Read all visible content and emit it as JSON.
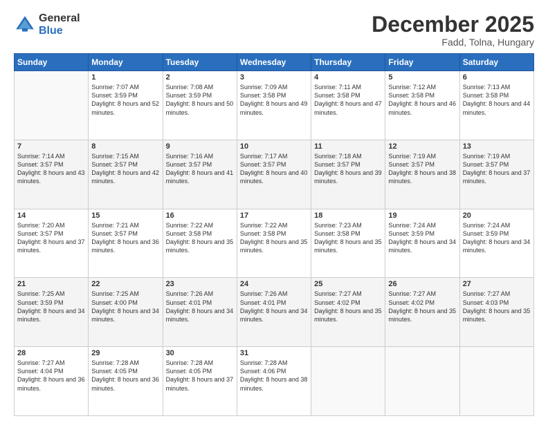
{
  "logo": {
    "general": "General",
    "blue": "Blue"
  },
  "header": {
    "month": "December 2025",
    "location": "Fadd, Tolna, Hungary"
  },
  "weekdays": [
    "Sunday",
    "Monday",
    "Tuesday",
    "Wednesday",
    "Thursday",
    "Friday",
    "Saturday"
  ],
  "weeks": [
    [
      {
        "day": "",
        "sunrise": "",
        "sunset": "",
        "daylight": ""
      },
      {
        "day": "1",
        "sunrise": "Sunrise: 7:07 AM",
        "sunset": "Sunset: 3:59 PM",
        "daylight": "Daylight: 8 hours and 52 minutes."
      },
      {
        "day": "2",
        "sunrise": "Sunrise: 7:08 AM",
        "sunset": "Sunset: 3:59 PM",
        "daylight": "Daylight: 8 hours and 50 minutes."
      },
      {
        "day": "3",
        "sunrise": "Sunrise: 7:09 AM",
        "sunset": "Sunset: 3:58 PM",
        "daylight": "Daylight: 8 hours and 49 minutes."
      },
      {
        "day": "4",
        "sunrise": "Sunrise: 7:11 AM",
        "sunset": "Sunset: 3:58 PM",
        "daylight": "Daylight: 8 hours and 47 minutes."
      },
      {
        "day": "5",
        "sunrise": "Sunrise: 7:12 AM",
        "sunset": "Sunset: 3:58 PM",
        "daylight": "Daylight: 8 hours and 46 minutes."
      },
      {
        "day": "6",
        "sunrise": "Sunrise: 7:13 AM",
        "sunset": "Sunset: 3:58 PM",
        "daylight": "Daylight: 8 hours and 44 minutes."
      }
    ],
    [
      {
        "day": "7",
        "sunrise": "Sunrise: 7:14 AM",
        "sunset": "Sunset: 3:57 PM",
        "daylight": "Daylight: 8 hours and 43 minutes."
      },
      {
        "day": "8",
        "sunrise": "Sunrise: 7:15 AM",
        "sunset": "Sunset: 3:57 PM",
        "daylight": "Daylight: 8 hours and 42 minutes."
      },
      {
        "day": "9",
        "sunrise": "Sunrise: 7:16 AM",
        "sunset": "Sunset: 3:57 PM",
        "daylight": "Daylight: 8 hours and 41 minutes."
      },
      {
        "day": "10",
        "sunrise": "Sunrise: 7:17 AM",
        "sunset": "Sunset: 3:57 PM",
        "daylight": "Daylight: 8 hours and 40 minutes."
      },
      {
        "day": "11",
        "sunrise": "Sunrise: 7:18 AM",
        "sunset": "Sunset: 3:57 PM",
        "daylight": "Daylight: 8 hours and 39 minutes."
      },
      {
        "day": "12",
        "sunrise": "Sunrise: 7:19 AM",
        "sunset": "Sunset: 3:57 PM",
        "daylight": "Daylight: 8 hours and 38 minutes."
      },
      {
        "day": "13",
        "sunrise": "Sunrise: 7:19 AM",
        "sunset": "Sunset: 3:57 PM",
        "daylight": "Daylight: 8 hours and 37 minutes."
      }
    ],
    [
      {
        "day": "14",
        "sunrise": "Sunrise: 7:20 AM",
        "sunset": "Sunset: 3:57 PM",
        "daylight": "Daylight: 8 hours and 37 minutes."
      },
      {
        "day": "15",
        "sunrise": "Sunrise: 7:21 AM",
        "sunset": "Sunset: 3:57 PM",
        "daylight": "Daylight: 8 hours and 36 minutes."
      },
      {
        "day": "16",
        "sunrise": "Sunrise: 7:22 AM",
        "sunset": "Sunset: 3:58 PM",
        "daylight": "Daylight: 8 hours and 35 minutes."
      },
      {
        "day": "17",
        "sunrise": "Sunrise: 7:22 AM",
        "sunset": "Sunset: 3:58 PM",
        "daylight": "Daylight: 8 hours and 35 minutes."
      },
      {
        "day": "18",
        "sunrise": "Sunrise: 7:23 AM",
        "sunset": "Sunset: 3:58 PM",
        "daylight": "Daylight: 8 hours and 35 minutes."
      },
      {
        "day": "19",
        "sunrise": "Sunrise: 7:24 AM",
        "sunset": "Sunset: 3:59 PM",
        "daylight": "Daylight: 8 hours and 34 minutes."
      },
      {
        "day": "20",
        "sunrise": "Sunrise: 7:24 AM",
        "sunset": "Sunset: 3:59 PM",
        "daylight": "Daylight: 8 hours and 34 minutes."
      }
    ],
    [
      {
        "day": "21",
        "sunrise": "Sunrise: 7:25 AM",
        "sunset": "Sunset: 3:59 PM",
        "daylight": "Daylight: 8 hours and 34 minutes."
      },
      {
        "day": "22",
        "sunrise": "Sunrise: 7:25 AM",
        "sunset": "Sunset: 4:00 PM",
        "daylight": "Daylight: 8 hours and 34 minutes."
      },
      {
        "day": "23",
        "sunrise": "Sunrise: 7:26 AM",
        "sunset": "Sunset: 4:01 PM",
        "daylight": "Daylight: 8 hours and 34 minutes."
      },
      {
        "day": "24",
        "sunrise": "Sunrise: 7:26 AM",
        "sunset": "Sunset: 4:01 PM",
        "daylight": "Daylight: 8 hours and 34 minutes."
      },
      {
        "day": "25",
        "sunrise": "Sunrise: 7:27 AM",
        "sunset": "Sunset: 4:02 PM",
        "daylight": "Daylight: 8 hours and 35 minutes."
      },
      {
        "day": "26",
        "sunrise": "Sunrise: 7:27 AM",
        "sunset": "Sunset: 4:02 PM",
        "daylight": "Daylight: 8 hours and 35 minutes."
      },
      {
        "day": "27",
        "sunrise": "Sunrise: 7:27 AM",
        "sunset": "Sunset: 4:03 PM",
        "daylight": "Daylight: 8 hours and 35 minutes."
      }
    ],
    [
      {
        "day": "28",
        "sunrise": "Sunrise: 7:27 AM",
        "sunset": "Sunset: 4:04 PM",
        "daylight": "Daylight: 8 hours and 36 minutes."
      },
      {
        "day": "29",
        "sunrise": "Sunrise: 7:28 AM",
        "sunset": "Sunset: 4:05 PM",
        "daylight": "Daylight: 8 hours and 36 minutes."
      },
      {
        "day": "30",
        "sunrise": "Sunrise: 7:28 AM",
        "sunset": "Sunset: 4:05 PM",
        "daylight": "Daylight: 8 hours and 37 minutes."
      },
      {
        "day": "31",
        "sunrise": "Sunrise: 7:28 AM",
        "sunset": "Sunset: 4:06 PM",
        "daylight": "Daylight: 8 hours and 38 minutes."
      },
      {
        "day": "",
        "sunrise": "",
        "sunset": "",
        "daylight": ""
      },
      {
        "day": "",
        "sunrise": "",
        "sunset": "",
        "daylight": ""
      },
      {
        "day": "",
        "sunrise": "",
        "sunset": "",
        "daylight": ""
      }
    ]
  ]
}
